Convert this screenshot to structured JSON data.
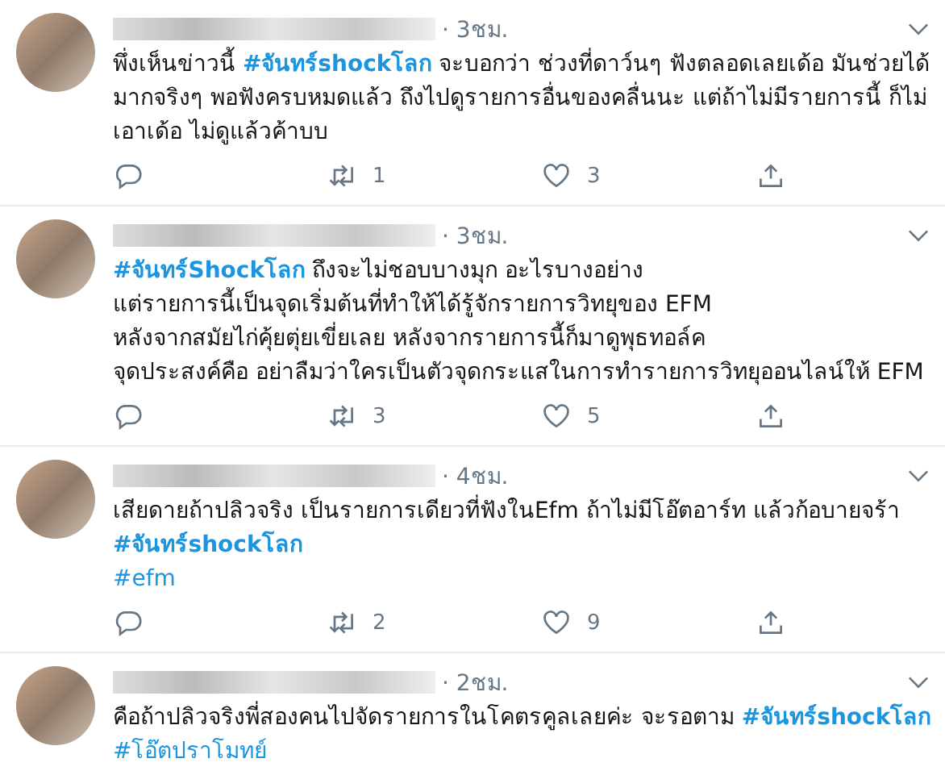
{
  "tweets": [
    {
      "time": "· 3ชม.",
      "body": [
        {
          "kind": "text",
          "text": "พึ่งเห็นข่าวนี้ "
        },
        {
          "kind": "hashtag",
          "text": "#จันทร์shockโลก",
          "highlighted": true
        },
        {
          "kind": "text",
          "text": " จะบอกว่า ช่วงที่ดาว์นๆ ฟังตลอดเลยเด้อ มันช่วยได้"
        },
        {
          "kind": "break"
        },
        {
          "kind": "text",
          "text": "มากจริงๆ พอฟังครบหมดแล้ว ถึงไปดูรายการอื่นของคลื่นนะ แต่ถ้าไม่มีรายการนี้ ก็ไม่"
        },
        {
          "kind": "break"
        },
        {
          "kind": "text",
          "text": "เอาเด้อ ไม่ดูแล้วค้าบบ"
        }
      ],
      "retweets": "1",
      "likes": "3"
    },
    {
      "time": "· 3ชม.",
      "body": [
        {
          "kind": "hashtag",
          "text": "#จันทร์Shockโลก",
          "highlighted": true
        },
        {
          "kind": "text",
          "text": " ถึงจะไม่ชอบบางมุก อะไรบางอย่าง"
        },
        {
          "kind": "break"
        },
        {
          "kind": "text",
          "text": "แต่รายการนี้เป็นจุดเริ่มต้นที่ทำให้ได้รู้จักรายการวิทยุของ EFM"
        },
        {
          "kind": "break"
        },
        {
          "kind": "text",
          "text": "หลังจากสมัยไก่คุ้ยตุ่ยเขี่ยเลย หลังจากรายการนี้ก็มาดูพุธทอล์ค"
        },
        {
          "kind": "break"
        },
        {
          "kind": "text",
          "text": "จุดประสงค์คือ อย่าลืมว่าใครเป็นตัวจุดกระแสในการทำรายการวิทยุออนไลน์ให้ EFM"
        }
      ],
      "retweets": "3",
      "likes": "5"
    },
    {
      "time": "· 4ชม.",
      "body": [
        {
          "kind": "text",
          "text": "เสียดายถ้าปลิวจริง เป็นรายการเดียวที่ฟังในEfm ถ้าไม่มีโอ๊ตอาร์ท แล้วก้อบายจร้า"
        },
        {
          "kind": "break"
        },
        {
          "kind": "hashtag",
          "text": "#จันทร์shockโลก",
          "highlighted": true
        },
        {
          "kind": "break"
        },
        {
          "kind": "hashtag",
          "text": "#efm",
          "highlighted": false
        }
      ],
      "retweets": "2",
      "likes": "9"
    },
    {
      "time": "· 2ชม.",
      "body": [
        {
          "kind": "text",
          "text": "คือถ้าปลิวจริงพี่สองคนไปจัดรายการในโคตรคูลเลยค่ะ จะรอตาม "
        },
        {
          "kind": "hashtag",
          "text": "#จันทร์shockโลก",
          "highlighted": true
        },
        {
          "kind": "break"
        },
        {
          "kind": "hashtag",
          "text": "#โอ๊ตปราโมทย์",
          "highlighted": false
        }
      ]
    }
  ]
}
